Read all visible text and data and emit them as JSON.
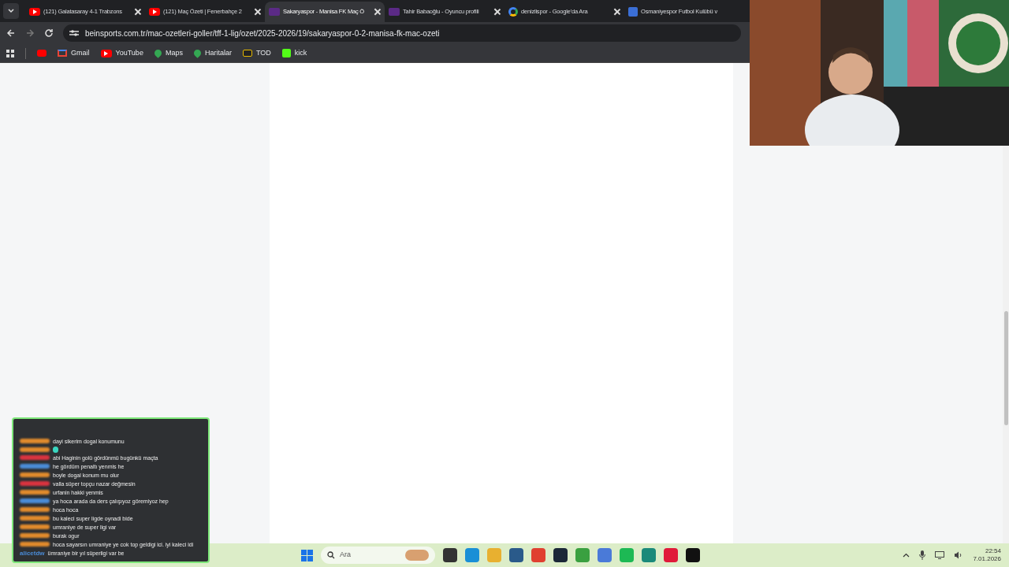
{
  "tabs": [
    {
      "title": "(121) Galatasaray 4-1 Trabzons",
      "kind": "youtube",
      "selected": false
    },
    {
      "title": "(121) Maç Özeti | Fenerbahçe 2",
      "kind": "youtube",
      "selected": false
    },
    {
      "title": "Sakaryaspor - Manisa FK Maç Ö",
      "kind": "bein",
      "selected": true
    },
    {
      "title": "Tahir Babaoğlu - Oyuncu profili",
      "kind": "bein",
      "selected": false
    },
    {
      "title": "denizlispor - Google'da Ara",
      "kind": "google",
      "selected": false
    },
    {
      "title": "Osmaniyespor Futbol Kulübü v",
      "kind": "m",
      "selected": false
    }
  ],
  "address": "beinsports.com.tr/mac-ozetleri-goller/tff-1-lig/ozet/2025-2026/19/sakaryaspor-0-2-manisa-fk-mac-ozeti",
  "bookmarks": [
    {
      "label": "Gmail",
      "kind": "gmail"
    },
    {
      "label": "YouTube",
      "kind": "youtube"
    },
    {
      "label": "Maps",
      "kind": "maps"
    },
    {
      "label": "Haritalar",
      "kind": "maps"
    },
    {
      "label": "TOD",
      "kind": "tod"
    },
    {
      "label": "kick",
      "kind": "kick"
    }
  ],
  "chat": [
    {
      "text": "dayi sikerim dogal konumunu",
      "color": "#e08a2c"
    },
    {
      "kind": "emote",
      "color": "#e08a2c"
    },
    {
      "text": "abi Haginin golü gördünmü bugünkü maçta",
      "color": "#d9333f"
    },
    {
      "text": "he gördüm penaltı yenmis he",
      "color": "#4a8bd6"
    },
    {
      "text": "boyle dogal konum mu olur",
      "color": "#e08a2c"
    },
    {
      "text": "valla süper topçu nazar değmesin",
      "color": "#d9333f"
    },
    {
      "text": "urfanin hakki yenmis",
      "color": "#e08a2c"
    },
    {
      "text": "ya hoca arada da ders çalışıyoz göremiyoz hep",
      "color": "#4a8bd6"
    },
    {
      "text": "hoca hoca",
      "color": "#e08a2c"
    },
    {
      "text": "bu kaleci super ligde oynadi bide",
      "color": "#e08a2c"
    },
    {
      "text": "umraniye de super ligi var",
      "color": "#e08a2c"
    },
    {
      "text": "burak ogur",
      "color": "#e08a2c"
    },
    {
      "text": "hoca sayarsın umraniye ye cok top geldigi ici. iyi kaleci idi",
      "color": "#e08a2c"
    },
    {
      "user": "alicetdw",
      "text": "ümraniye bir yıl süperligi var be",
      "color": "#4a8bd6"
    }
  ],
  "taskbar": {
    "search_placeholder": "Ara",
    "time": "22:54",
    "date": "7.01.2026"
  }
}
